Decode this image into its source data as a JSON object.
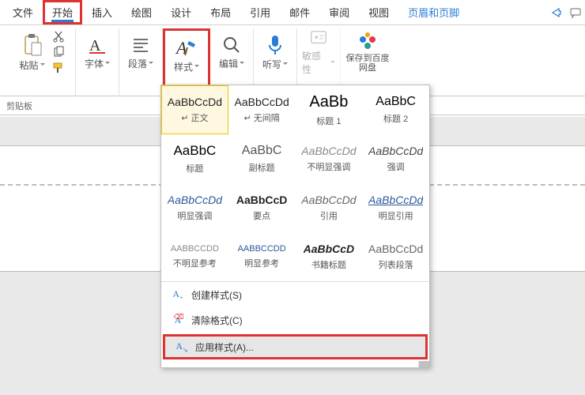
{
  "menu": {
    "file": "文件",
    "home": "开始",
    "insert": "插入",
    "draw": "绘图",
    "design": "设计",
    "layout": "布局",
    "references": "引用",
    "mail": "邮件",
    "review": "审阅",
    "view": "视图",
    "headerfooter": "页眉和页脚"
  },
  "ribbon": {
    "clipboard_label": "剪贴板",
    "paste": "粘贴",
    "font": "字体",
    "paragraph": "段落",
    "styles": "样式",
    "edit": "编辑",
    "dictate": "听写",
    "sensitivity": "敏感性",
    "save_baidu": "保存到百度网盘"
  },
  "gallery": [
    {
      "preview": "AaBbCcDd",
      "name": "正文",
      "cls": "sel",
      "style": ""
    },
    {
      "preview": "AaBbCcDd",
      "name": "无间隔",
      "style": ""
    },
    {
      "preview": "AaBb",
      "name": "标题 1",
      "style": "font-size:20px;color:#000;"
    },
    {
      "preview": "AaBbC",
      "name": "标题 2",
      "style": "font-size:16px;color:#000;"
    },
    {
      "preview": "AaBbC",
      "name": "标题",
      "style": "font-size:17px;color:#000;"
    },
    {
      "preview": "AaBbC",
      "name": "副标题",
      "style": "font-size:16px;color:#555;"
    },
    {
      "preview": "AaBbCcDd",
      "name": "不明显强调",
      "style": "font-style:italic;color:#888;"
    },
    {
      "preview": "AaBbCcDd",
      "name": "强调",
      "style": "font-style:italic;color:#444;"
    },
    {
      "preview": "AaBbCcDd",
      "name": "明显强调",
      "style": "font-style:italic;color:#2b579a;"
    },
    {
      "preview": "AaBbCcD",
      "name": "要点",
      "style": "font-weight:bold;"
    },
    {
      "preview": "AaBbCcDd",
      "name": "引用",
      "style": "font-style:italic;color:#666;"
    },
    {
      "preview": "AaBbCcDd",
      "name": "明显引用",
      "style": "font-style:italic;color:#2b579a;text-decoration:underline;"
    },
    {
      "preview": "AABBCCDD",
      "name": "不明显参考",
      "style": "font-size:11px;color:#888;"
    },
    {
      "preview": "AABBCCDD",
      "name": "明显参考",
      "style": "font-size:11px;color:#2b579a;"
    },
    {
      "preview": "AaBbCcD",
      "name": "书籍标题",
      "style": "font-weight:bold;font-style:italic;"
    },
    {
      "preview": "AaBbCcDd",
      "name": "列表段落",
      "style": "color:#666;"
    }
  ],
  "panel_menu": {
    "create": "创建样式(S)",
    "clear": "清除格式(C)",
    "apply": "应用样式(A)..."
  }
}
